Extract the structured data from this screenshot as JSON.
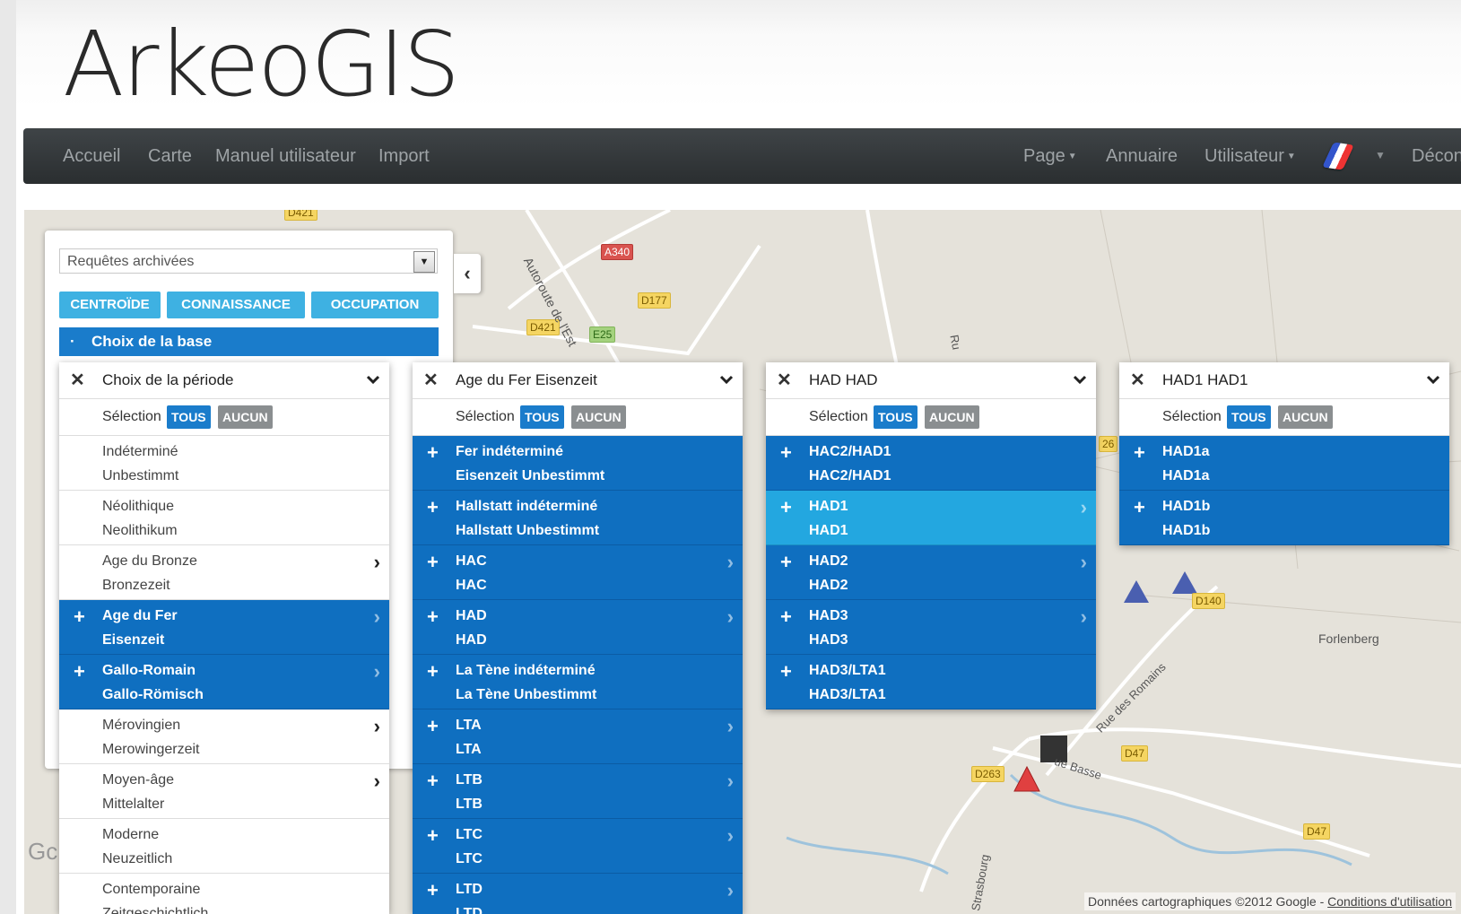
{
  "logo": "ArkeoGIS",
  "nav": {
    "left": [
      "Accueil",
      "Carte",
      "Manuel utilisateur",
      "Import"
    ],
    "page": "Page",
    "annuaire": "Annuaire",
    "utilisateur": "Utilisateur",
    "logout": "Décon"
  },
  "panel": {
    "archived_placeholder": "Requêtes archivées",
    "filters": [
      "CENTROÏDE",
      "CONNAISSANCE",
      "OCCUPATION"
    ],
    "base_bar": "Choix de la base",
    "collapse_icon": "chevron-left-icon"
  },
  "selection": {
    "label": "Sélection",
    "all": "TOUS",
    "none": "AUCUN"
  },
  "columns": [
    {
      "title": "Choix de la période",
      "items": [
        {
          "l1": "Indéterminé",
          "l2": "Unbestimmt",
          "state": "none",
          "sub": false
        },
        {
          "l1": "Néolithique",
          "l2": "Neolithikum",
          "state": "none",
          "sub": false
        },
        {
          "l1": "Age du Bronze",
          "l2": "Bronzezeit",
          "state": "none",
          "sub": true
        },
        {
          "l1": "Age du Fer",
          "l2": "Eisenzeit",
          "state": "selected",
          "sub": true
        },
        {
          "l1": "Gallo-Romain",
          "l2": "Gallo-Römisch",
          "state": "selected",
          "sub": true
        },
        {
          "l1": "Mérovingien",
          "l2": "Merowingerzeit",
          "state": "none",
          "sub": true
        },
        {
          "l1": "Moyen-âge",
          "l2": "Mittelalter",
          "state": "none",
          "sub": true
        },
        {
          "l1": "Moderne",
          "l2": "Neuzeitlich",
          "state": "none",
          "sub": false
        },
        {
          "l1": "Contemporaine",
          "l2": "Zeitgeschichtlich",
          "state": "none",
          "sub": false
        }
      ]
    },
    {
      "title": "Age du Fer Eisenzeit",
      "items": [
        {
          "l1": "Fer indéterminé",
          "l2": "Eisenzeit Unbestimmt",
          "state": "selected",
          "sub": false
        },
        {
          "l1": "Hallstatt indéterminé",
          "l2": "Hallstatt Unbestimmt",
          "state": "selected",
          "sub": false
        },
        {
          "l1": "HAC",
          "l2": "HAC",
          "state": "selected",
          "sub": true
        },
        {
          "l1": "HAD",
          "l2": "HAD",
          "state": "selected",
          "sub": true
        },
        {
          "l1": "La Tène indéterminé",
          "l2": "La Tène Unbestimmt",
          "state": "selected",
          "sub": false
        },
        {
          "l1": "LTA",
          "l2": "LTA",
          "state": "selected",
          "sub": true
        },
        {
          "l1": "LTB",
          "l2": "LTB",
          "state": "selected",
          "sub": true
        },
        {
          "l1": "LTC",
          "l2": "LTC",
          "state": "selected",
          "sub": true
        },
        {
          "l1": "LTD",
          "l2": "LTD",
          "state": "selected",
          "sub": true
        }
      ]
    },
    {
      "title": "HAD HAD",
      "items": [
        {
          "l1": "HAC2/HAD1",
          "l2": "HAC2/HAD1",
          "state": "selected",
          "sub": false
        },
        {
          "l1": "HAD1",
          "l2": "HAD1",
          "state": "highlight",
          "sub": true
        },
        {
          "l1": "HAD2",
          "l2": "HAD2",
          "state": "selected",
          "sub": true
        },
        {
          "l1": "HAD3",
          "l2": "HAD3",
          "state": "selected",
          "sub": true
        },
        {
          "l1": "HAD3/LTA1",
          "l2": "HAD3/LTA1",
          "state": "selected",
          "sub": false
        }
      ]
    },
    {
      "title": "HAD1 HAD1",
      "items": [
        {
          "l1": "HAD1a",
          "l2": "HAD1a",
          "state": "selected",
          "sub": false
        },
        {
          "l1": "HAD1b",
          "l2": "HAD1b",
          "state": "selected",
          "sub": false
        }
      ]
    }
  ],
  "map": {
    "roads": [
      "D421",
      "A340",
      "D177",
      "D421",
      "E25",
      "D140",
      "D47",
      "D263",
      "D47",
      "26"
    ],
    "places": [
      "Autoroute de l'Est",
      "Forlenberg",
      "Rue des Romains",
      "ue Basse",
      "Strasbourg",
      "Ru",
      "Gc"
    ],
    "credit": "Données cartographiques ©2012 Google -",
    "terms": "Conditions d'utilisation",
    "colors": {
      "site_blue": "#4a5fb0",
      "site_red": "#e04040",
      "site_dark": "#333333"
    }
  }
}
